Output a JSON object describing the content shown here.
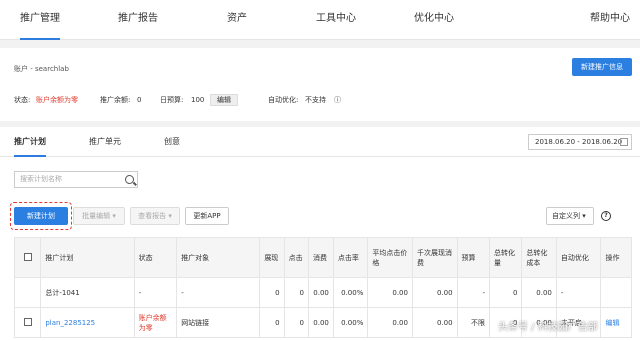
{
  "topnav": {
    "items": [
      "推广管理",
      "推广报告",
      "资产",
      "工具中心",
      "优化中心",
      "帮助中心"
    ]
  },
  "account": {
    "name": "账户 - searchlab",
    "new_info_button": "新建推广信息",
    "status_label": "状态:",
    "status_value": "账户余额为零",
    "balance_label": "推广余额:",
    "balance_value": "0",
    "budget_label": "日预算:",
    "budget_value": "100",
    "edit_button": "编辑",
    "auto_opt": "自动优化:",
    "auto_opt_value": "不支持"
  },
  "tabs": [
    "推广计划",
    "推广单元",
    "创意"
  ],
  "date_range": "2018.06.20 - 2018.06.20",
  "search_placeholder": "搜索计划名称",
  "toolbar": {
    "new_plan": "新建计划",
    "batch_edit": "批量编辑",
    "view_report": "查看报告",
    "update_app": "更新APP",
    "custom_cols": "自定义列"
  },
  "table": {
    "headers": [
      "推广计划",
      "状态",
      "推广对象",
      "展现",
      "点击",
      "消费",
      "点击率",
      "平均点击价格",
      "千次展现消费",
      "预算",
      "总转化量",
      "总转化成本",
      "自动优化",
      "操作"
    ],
    "total_row": [
      "总计-1041",
      "-",
      "-",
      "0",
      "0",
      "0.00",
      "0.00%",
      "0.00",
      "0.00",
      "-",
      "0",
      "0.00",
      "-",
      ""
    ],
    "row1": [
      "plan_2285125",
      "账户余额为零",
      "网站链接",
      "0",
      "0",
      "0.00",
      "0.00%",
      "0.00",
      "0.00",
      "不限",
      "0",
      "0.00",
      "未开启",
      "编辑"
    ]
  },
  "watermark": "头条号 / 科技园广告部"
}
